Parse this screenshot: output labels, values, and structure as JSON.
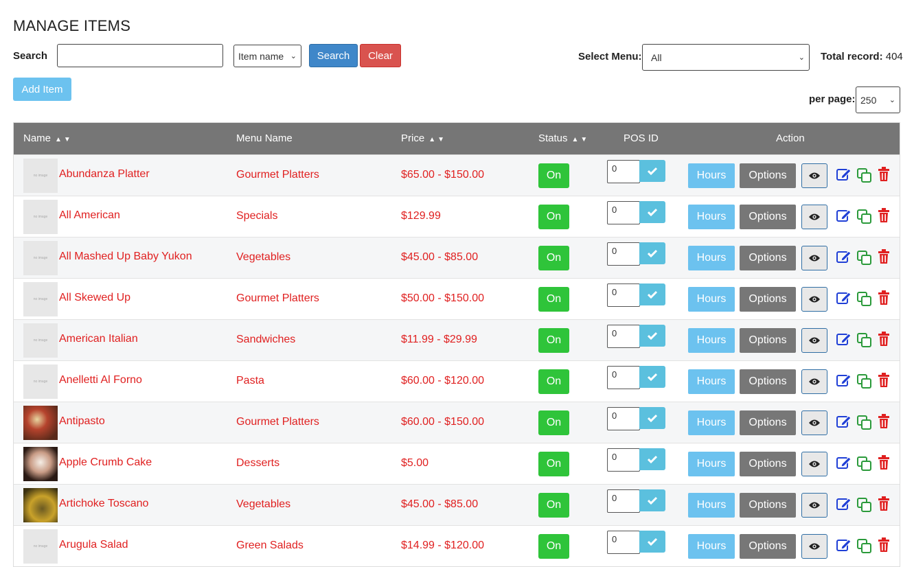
{
  "header": {
    "title": "MANAGE ITEMS"
  },
  "search": {
    "label": "Search",
    "value": "",
    "type_selected": "Item name",
    "search_button": "Search",
    "clear_button": "Clear"
  },
  "add_button": "Add Item",
  "select_menu": {
    "label": "Select Menu:",
    "selected": "All"
  },
  "total": {
    "label": "Total record:",
    "value": "404"
  },
  "per_page": {
    "label": "per page:",
    "selected": "250"
  },
  "columns": {
    "name": "Name",
    "menu": "Menu Name",
    "price": "Price",
    "status": "Status",
    "pos": "POS ID",
    "action": "Action"
  },
  "thumb_placeholder": "no image",
  "actions": {
    "hours": "Hours",
    "options": "Options"
  },
  "colors": {
    "link_red": "#e02020",
    "status_green": "#2fc43a",
    "header_gray": "#767676",
    "accent_blue": "#3f87c9",
    "danger": "#d9534f"
  },
  "rows": [
    {
      "name": "Abundanza Platter",
      "menu": "Gourmet Platters",
      "price": "$65.00 - $150.00",
      "status": "On",
      "pos": "0",
      "thumb": "none"
    },
    {
      "name": "All American",
      "menu": "Specials",
      "price": "$129.99",
      "status": "On",
      "pos": "0",
      "thumb": "none"
    },
    {
      "name": "All Mashed Up Baby Yukon",
      "menu": "Vegetables",
      "price": "$45.00 - $85.00",
      "status": "On",
      "pos": "0",
      "thumb": "none"
    },
    {
      "name": "All Skewed Up",
      "menu": "Gourmet Platters",
      "price": "$50.00 - $150.00",
      "status": "On",
      "pos": "0",
      "thumb": "none"
    },
    {
      "name": "American Italian",
      "menu": "Sandwiches",
      "price": "$11.99 - $29.99",
      "status": "On",
      "pos": "0",
      "thumb": "none"
    },
    {
      "name": "Anelletti Al Forno",
      "menu": "Pasta",
      "price": "$60.00 - $120.00",
      "status": "On",
      "pos": "0",
      "thumb": "none"
    },
    {
      "name": "Antipasto",
      "menu": "Gourmet Platters",
      "price": "$60.00 - $150.00",
      "status": "On",
      "pos": "0",
      "thumb": "photo1"
    },
    {
      "name": "Apple Crumb Cake",
      "menu": "Desserts",
      "price": "$5.00",
      "status": "On",
      "pos": "0",
      "thumb": "photo2"
    },
    {
      "name": "Artichoke Toscano",
      "menu": "Vegetables",
      "price": "$45.00 - $85.00",
      "status": "On",
      "pos": "0",
      "thumb": "photo3"
    },
    {
      "name": "Arugula Salad",
      "menu": "Green Salads",
      "price": "$14.99 - $120.00",
      "status": "On",
      "pos": "0",
      "thumb": "none"
    }
  ]
}
